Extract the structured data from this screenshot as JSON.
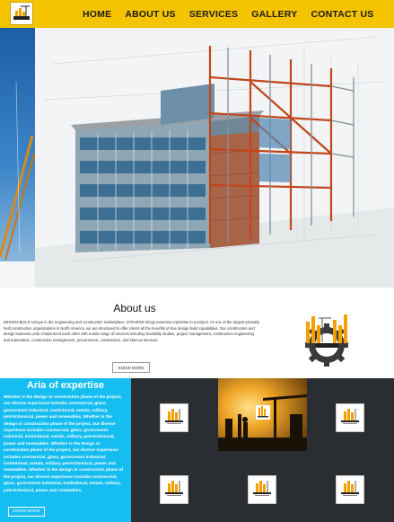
{
  "nav": {
    "logo_icon": "construction-logo-icon",
    "items": [
      {
        "label": "HOME"
      },
      {
        "label": "ABOUT US"
      },
      {
        "label": "SERVICES"
      },
      {
        "label": "GALLERY"
      },
      {
        "label": "CONTACT US"
      }
    ],
    "background_color": "#f5c400"
  },
  "hero": {
    "image": "steel-frame-building-photo"
  },
  "about": {
    "title": "About us",
    "text": "DESIGN-BUILD Unique in the engineering and construction marketplace, STEVENS brings extensive expertise to a project. As one of the largest privately held construction organizations in North America, we are structured to offer clients all the benefits of true design-build capabilities. Our construction and design business units complement each other with a wide range of services including feasibility studies, project management, construction engineering and automation, construction management, procurement, construction, and start-up services.",
    "button_label": "KNOW MORE",
    "logo_text": "CONSTRUCTION"
  },
  "expertise": {
    "title": "Aria of expertise",
    "text": "Whether is the design or construction phase of the project, our diverse experience includes commercial, glass, government industrial, institutional, metals, military, petro/chemical, power and renewables. Whether is the design or construction phase of the project, our diverse experience includes commercial, glass, government industrial, institutional, metals, military, petro/chemical, power and renewables. Whether is the design or construction phase of the project, our diverse experience includes commercial, glass, government industrial, institutional, metals, military, petro/chemical, power and renewables. Whether is the design or construction phase of the project, our diverse experience includes commercial, glass, government industrial, institutional, metals, military, petro/chemical, power and renewables.",
    "button_label": "KNOW MORE",
    "accent_color": "#16bdf0",
    "panel_color": "#2a2d31",
    "tiles": [
      {
        "icon": "construction-logo-icon"
      },
      {
        "icon": "construction-logo-icon"
      },
      {
        "icon": "construction-logo-icon"
      },
      {
        "icon": "construction-logo-icon"
      },
      {
        "icon": "construction-logo-icon"
      },
      {
        "icon": "construction-logo-icon"
      }
    ],
    "photo": "crane-silhouette-sunset-photo"
  }
}
